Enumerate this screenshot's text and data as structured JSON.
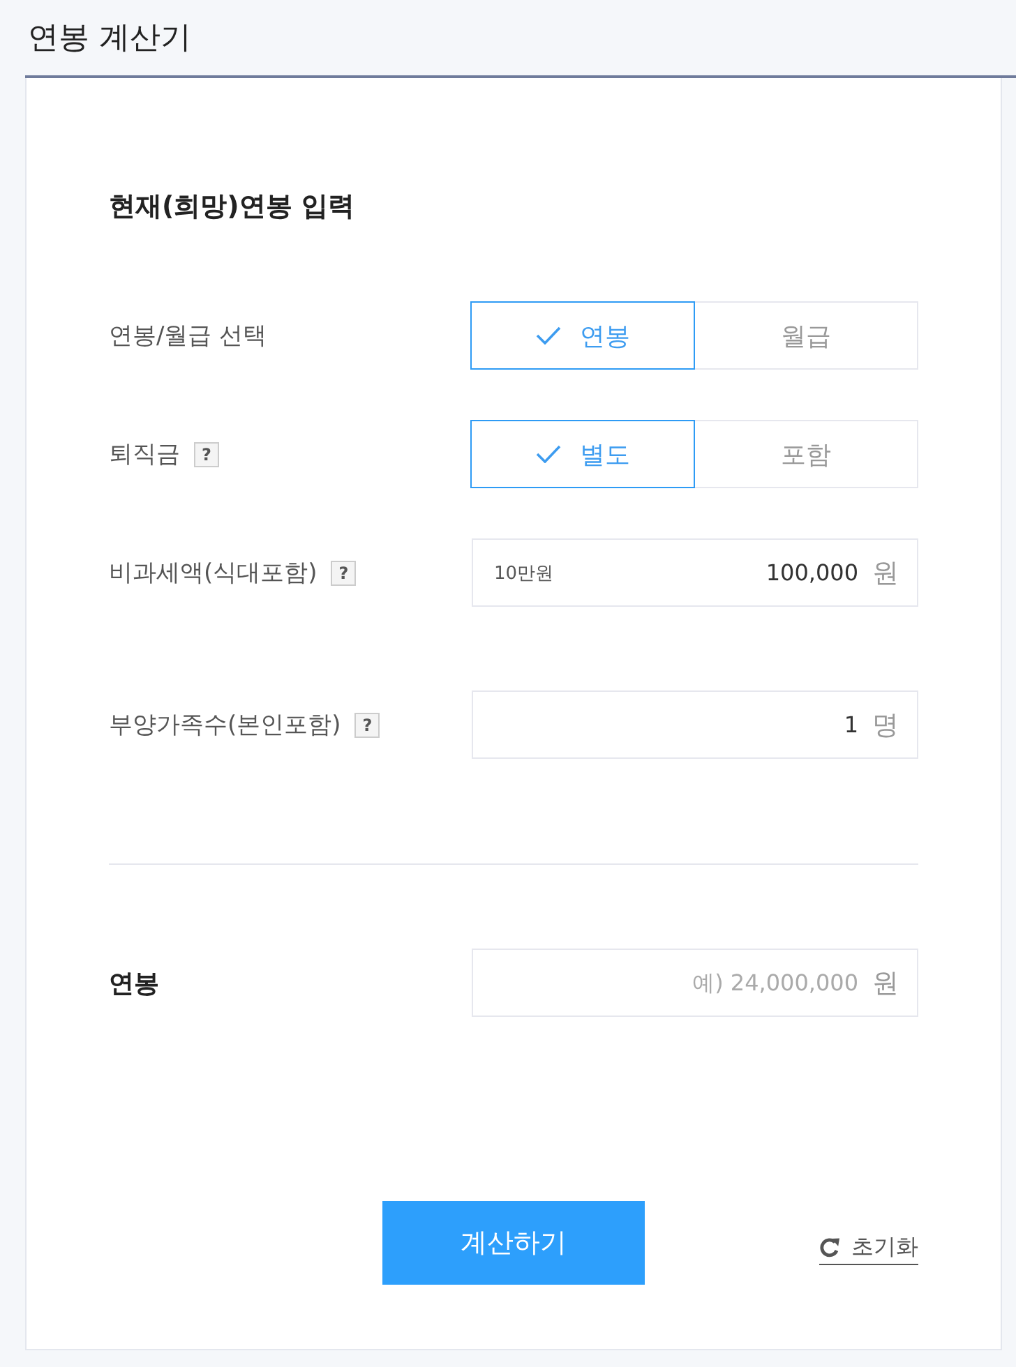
{
  "title": "연봉 계산기",
  "section": {
    "heading": "현재(희망)연봉 입력"
  },
  "rows": [
    {
      "kind": "toggle",
      "label": "연봉/월급 선택",
      "options": [
        {
          "label": "연봉",
          "selected": true
        },
        {
          "label": "월급",
          "selected": false
        }
      ]
    },
    {
      "kind": "toggle",
      "label": "퇴직금",
      "help": "?",
      "options": [
        {
          "label": "별도",
          "selected": true
        },
        {
          "label": "포함",
          "selected": false
        }
      ]
    },
    {
      "kind": "field",
      "label": "비과세액(식대포함)",
      "help": "?",
      "caption": "10만원",
      "value": "100,000",
      "unit": "원"
    },
    {
      "kind": "field",
      "label": "부양가족수(본인포함)",
      "help": "?",
      "value": "1",
      "unit": "명"
    }
  ],
  "salary": {
    "label": "연봉",
    "placeholder": "예) 24,000,000",
    "unit": "원"
  },
  "actions": {
    "calculate": "계산하기",
    "reset": "초기화"
  }
}
